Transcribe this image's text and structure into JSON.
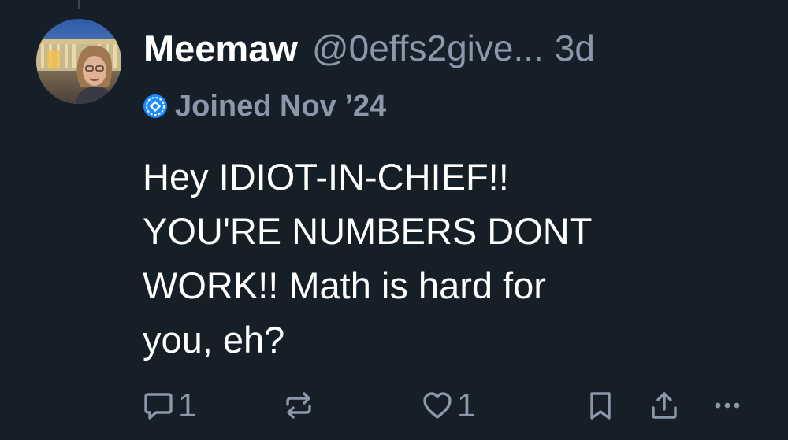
{
  "post": {
    "author": {
      "display_name": "Meemaw",
      "handle": "@0effs2give...",
      "joined_label": "Joined Nov ’24"
    },
    "timestamp": "3d",
    "text": "Hey IDIOT-IN-CHIEF!!\nYOU'RE NUMBERS DONT\nWORK!! Math is hard for\nyou, eh?",
    "actions": {
      "reply_count": "1",
      "like_count": "1"
    }
  },
  "icons": {
    "reply": "speech-bubble-icon",
    "repost": "repost-arrows-icon",
    "like": "heart-icon",
    "bookmark": "bookmark-icon",
    "share": "share-upload-icon",
    "more": "ellipsis-icon",
    "joined": "new-account-badge-icon"
  },
  "colors": {
    "background": "#161e27",
    "primary_text": "#ffffff",
    "secondary_text": "#8b98a9",
    "badge_accent": "#1a8cff"
  }
}
